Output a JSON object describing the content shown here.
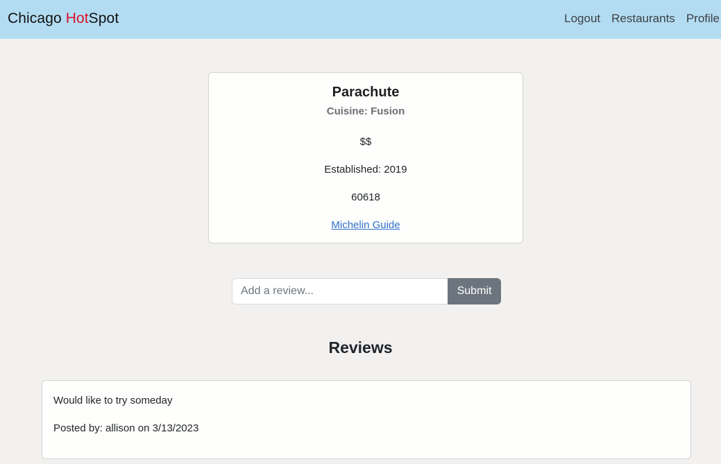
{
  "navbar": {
    "brand_prefix": "Chicago ",
    "brand_hot": "Hot",
    "brand_suffix": "Spot",
    "brand_hot_color": "#d9112b",
    "background_color": "#b3dcf2",
    "links": [
      "Logout",
      "Restaurants",
      "Profile"
    ]
  },
  "restaurant": {
    "name": "Parachute",
    "cuisine": "Cuisine: Fusion",
    "price": "$$",
    "established": "Established: 2019",
    "zip": "60618",
    "link_label": "Michelin Guide"
  },
  "review_form": {
    "placeholder": "Add a review...",
    "value": "",
    "submit_label": "Submit"
  },
  "reviews": {
    "heading": "Reviews",
    "items": [
      {
        "text": "Would like to try someday",
        "meta": "Posted by: allison on 3/13/2023"
      }
    ]
  }
}
